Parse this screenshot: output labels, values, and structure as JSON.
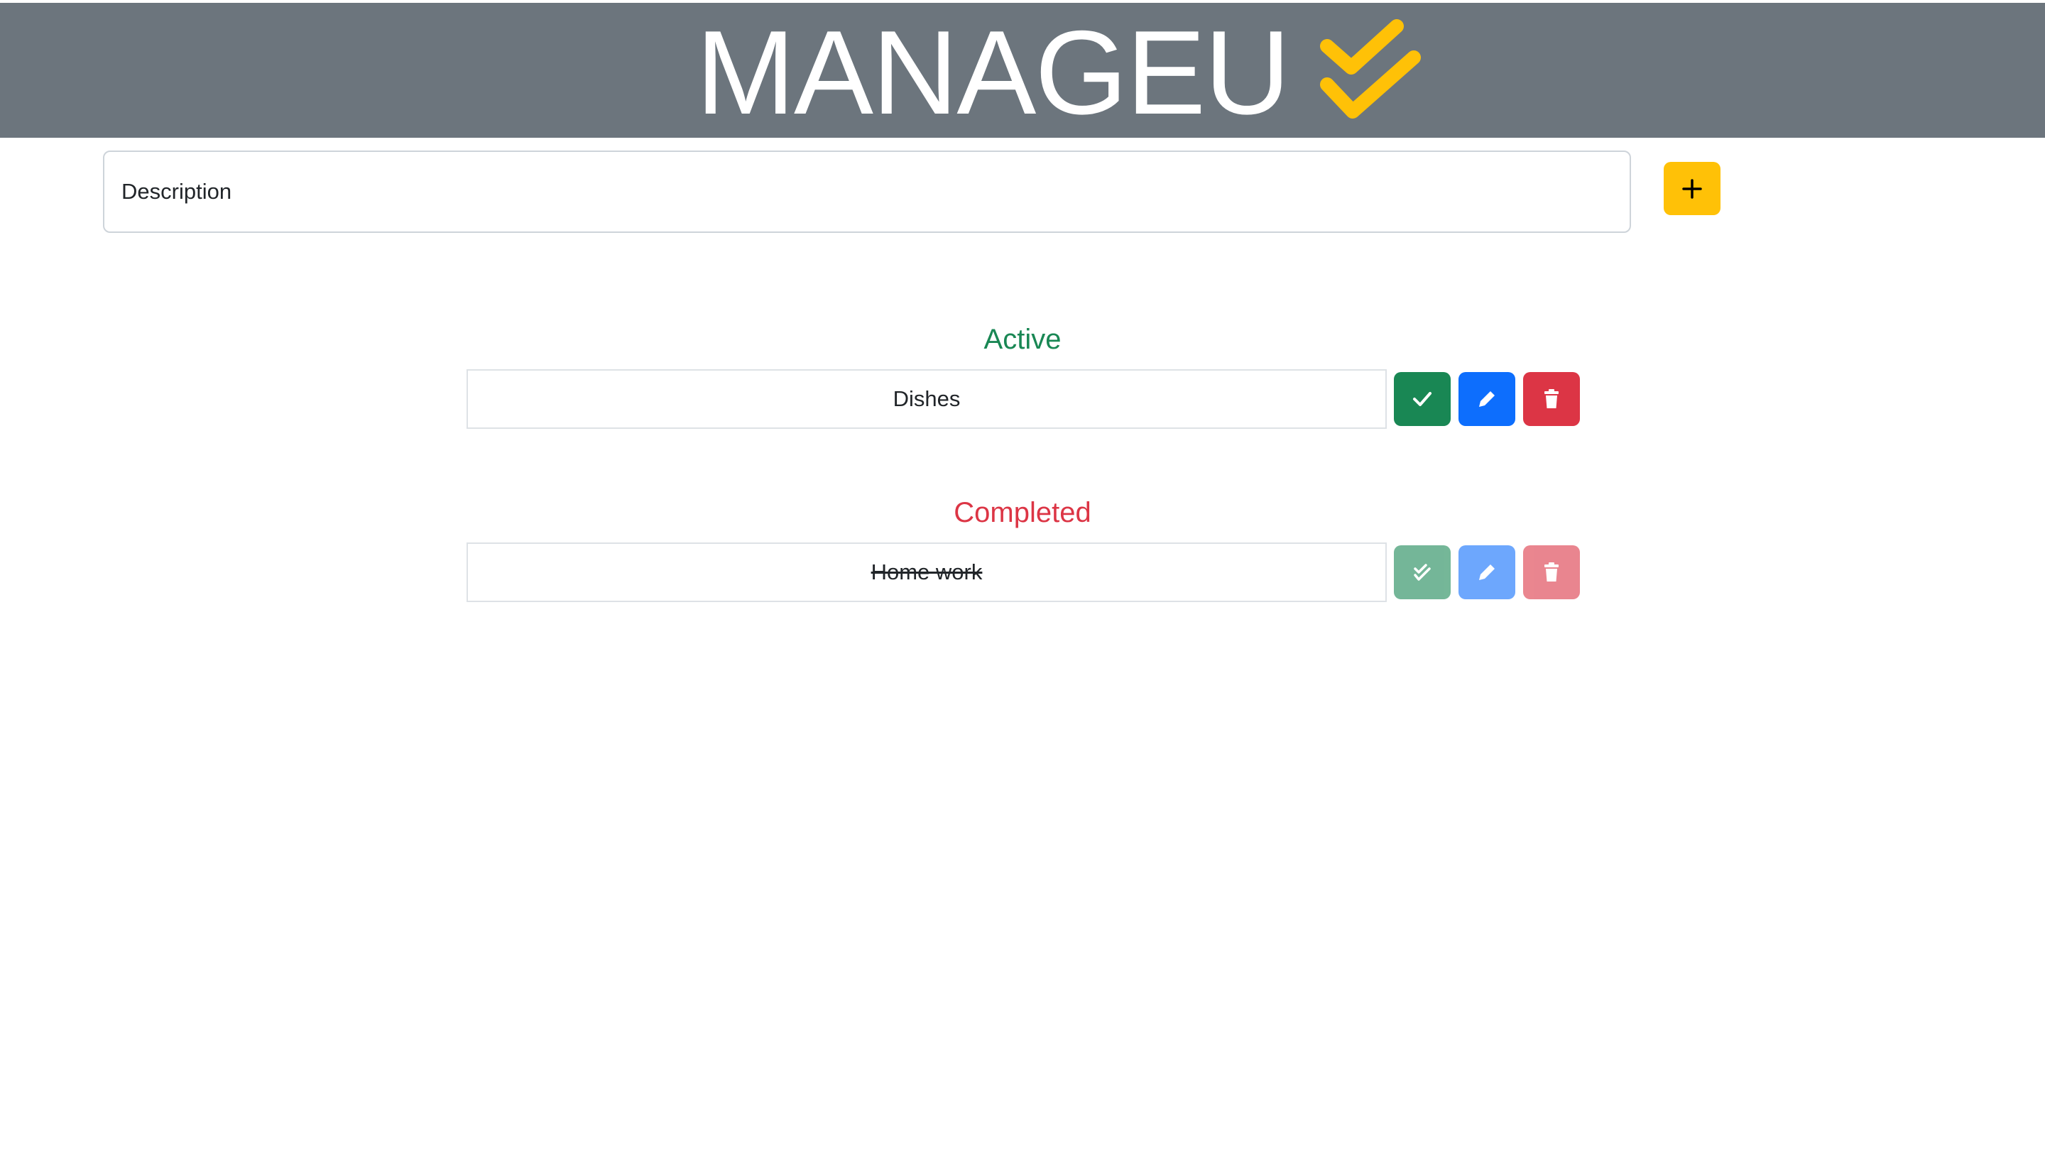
{
  "header": {
    "title": "MANAGEU",
    "logo_icon": "double-check-icon",
    "background_color": "#6c757d",
    "logo_color": "#ffc107"
  },
  "new_task": {
    "placeholder": "Description",
    "add_icon": "plus-icon",
    "add_button_color": "#ffc107"
  },
  "sections": {
    "active": {
      "title": "Active",
      "color": "#198754",
      "tasks": [
        {
          "text": "Dishes",
          "done_icon": "check-icon",
          "edit_icon": "pencil-icon",
          "delete_icon": "trash-icon"
        }
      ]
    },
    "completed": {
      "title": "Completed",
      "color": "#dc3545",
      "tasks": [
        {
          "text": "Home work",
          "done_icon": "double-check-icon",
          "edit_icon": "pencil-icon",
          "delete_icon": "trash-icon"
        }
      ]
    }
  },
  "colors": {
    "complete_button": "#198754",
    "edit_button": "#0d6efd",
    "delete_button": "#dc3545"
  }
}
